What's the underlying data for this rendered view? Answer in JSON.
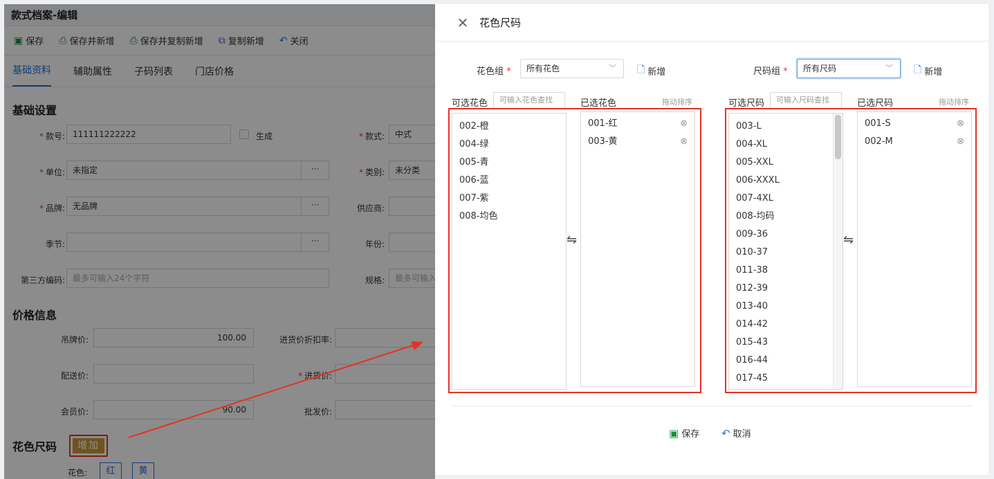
{
  "page": {
    "title": "款式档案-编辑",
    "toolbar": [
      {
        "label": "保存",
        "icon": "save-icon"
      },
      {
        "label": "保存并新增",
        "icon": "print-icon"
      },
      {
        "label": "保存并复制新增",
        "icon": "print-icon"
      },
      {
        "label": "复制新增",
        "icon": "copy-icon"
      },
      {
        "label": "关闭",
        "icon": "undo-icon"
      }
    ],
    "tabs": [
      "基础资料",
      "辅助属性",
      "子码列表",
      "门店价格"
    ],
    "basic_section": "基础设置",
    "fields": {
      "style_no": {
        "label": "款号:",
        "value": "111111222222"
      },
      "generate": {
        "label": "生成"
      },
      "style_type": {
        "label": "款式:",
        "value": "中式"
      },
      "unit": {
        "label": "单位:",
        "value": "未指定"
      },
      "category": {
        "label": "类别:",
        "value": "未分类"
      },
      "brand": {
        "label": "品牌:",
        "value": "无品牌"
      },
      "supplier": {
        "label": "供应商:",
        "value": ""
      },
      "season": {
        "label": "季节:",
        "value": ""
      },
      "year": {
        "label": "年份:",
        "value": ""
      },
      "third_code": {
        "label": "第三方编码:",
        "placeholder": "最多可输入24个字符"
      },
      "spec": {
        "label": "规格:",
        "placeholder": "最多可输入"
      }
    },
    "price_section": "价格信息",
    "prices": {
      "tag_price": {
        "label": "吊牌价:",
        "value": "100.00"
      },
      "purchase_discount": {
        "label": "进货价折扣率:",
        "value": ""
      },
      "delivery_price": {
        "label": "配送价:",
        "value": ""
      },
      "purchase_price": {
        "label": "进货价:",
        "value": ""
      },
      "member_price": {
        "label": "会员价:",
        "value": "90.00"
      },
      "wholesale_price": {
        "label": "批发价:",
        "value": ""
      }
    },
    "color_size_section": "花色尺码",
    "add_button": "增加",
    "color_label": "花色:",
    "color_chips": [
      "红",
      "黄"
    ],
    "dots": "···"
  },
  "dialog": {
    "title": "花色尺码",
    "color_group": {
      "label": "花色组",
      "value": "所有花色"
    },
    "size_group": {
      "label": "尺码组",
      "value": "所有尺码"
    },
    "new_label": "新增",
    "available_colors_label": "可选花色",
    "color_search_placeholder": "可输入花色查找",
    "selected_colors_label": "已选花色",
    "available_sizes_label": "可选尺码",
    "size_search_placeholder": "可输入尺码查找",
    "selected_sizes_label": "已选尺码",
    "drag_hint": "拖动排序",
    "available_colors": [
      "002-橙",
      "004-绿",
      "005-青",
      "006-蓝",
      "007-紫",
      "008-均色"
    ],
    "selected_colors": [
      "001-红",
      "003-黄"
    ],
    "available_sizes": [
      "003-L",
      "004-XL",
      "005-XXL",
      "006-XXXL",
      "007-4XL",
      "008-均码",
      "009-36",
      "010-37",
      "011-38",
      "012-39",
      "013-40",
      "014-42",
      "015-43",
      "016-44",
      "017-45"
    ],
    "selected_sizes": [
      "001-S",
      "002-M"
    ],
    "save_label": "保存",
    "cancel_label": "取消",
    "swap_symbol": "⇋"
  },
  "colors": {
    "accent": "#1f6fd6",
    "highlight": "#e53224",
    "add_button": "#c79a3a"
  }
}
